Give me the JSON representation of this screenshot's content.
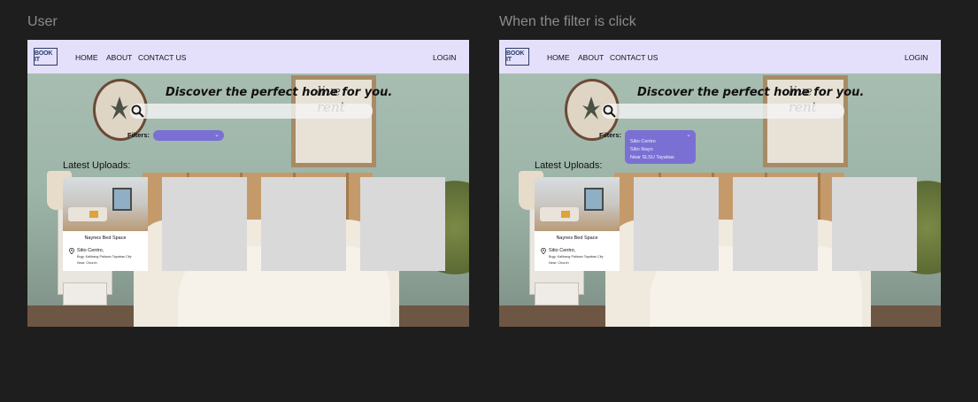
{
  "frames": [
    {
      "title": "User",
      "nav": {
        "logo": "BOOK IT",
        "links": [
          "HOME",
          "ABOUT",
          "CONTACT US"
        ],
        "login": "LOGIN"
      },
      "hero": {
        "tagline": "Discover the perfect home for you.",
        "wall_art_text": "live rent"
      },
      "filters": {
        "label": "Filters:",
        "state": "collapsed",
        "chevron": "chevron-down-icon",
        "options": []
      },
      "uploads": {
        "title": "Latest Uploads:",
        "listing": {
          "name": "Naynes Bed Space",
          "address_line1": "Sitio Centro,",
          "address_line2": "Brgy. Kalibang Paliwan Tayabas City",
          "address_line3": "Near: Church"
        }
      }
    },
    {
      "title": "When the filter is click",
      "nav": {
        "logo": "BOOK IT",
        "links": [
          "HOME",
          "ABOUT",
          "CONTACT US"
        ],
        "login": "LOGIN"
      },
      "hero": {
        "tagline": "Discover the perfect home for you.",
        "wall_art_text": "live rent"
      },
      "filters": {
        "label": "Filters:",
        "state": "expanded",
        "chevron": "chevron-down-icon",
        "options": [
          "Sitio Centro",
          "Sitio Ibayo",
          "Near SLSU Tayabas"
        ]
      },
      "uploads": {
        "title": "Latest Uploads:",
        "listing": {
          "name": "Naynes Bed Space",
          "address_line1": "Sitio Centro,",
          "address_line2": "Brgy. Kalibang Paliwan Tayabas City",
          "address_line3": "Near: Church"
        }
      }
    }
  ],
  "colors": {
    "canvas": "#1e1e1e",
    "frame_title": "#8c8c8c",
    "navbar": "#e4e0fc",
    "filter_accent": "#7a70d4",
    "placeholder_card": "#d9d9d9"
  }
}
